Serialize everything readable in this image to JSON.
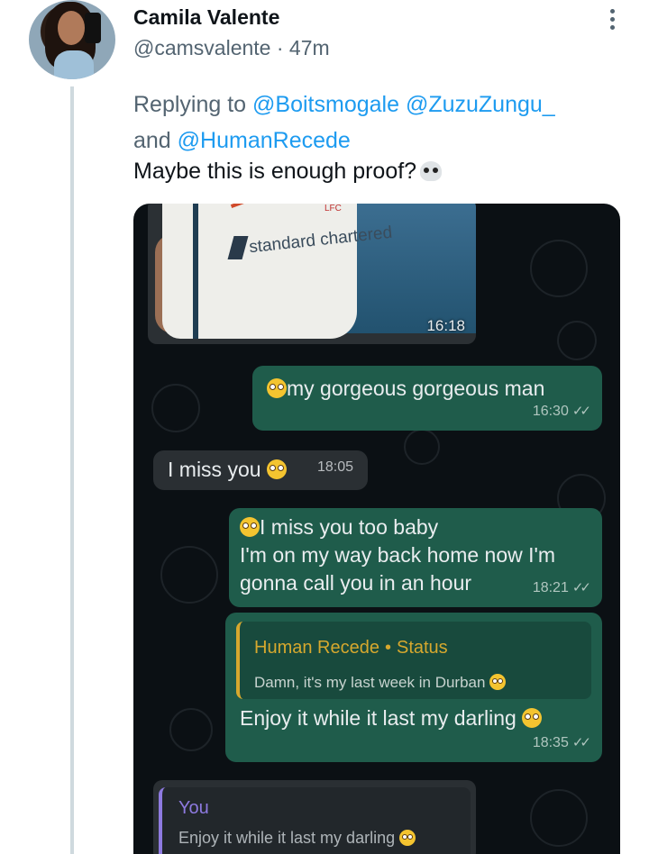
{
  "tweet": {
    "display_name": "Camila Valente",
    "handle": "@camsvalente",
    "dot": " · ",
    "time": "47m",
    "replying_prefix": "Replying to",
    "mention_1": "@Boitsmogale",
    "mention_2": "@ZuzuZungu_",
    "and_word": "and",
    "mention_3": "@HumanRecede",
    "text": "Maybe this is enough proof?"
  },
  "chat": {
    "photo": {
      "shirt_text": "standard chartered",
      "crest_text": "LFC",
      "time": "16:18"
    },
    "messages": [
      {
        "text": "my gorgeous gorgeous man",
        "time": "16:30"
      },
      {
        "text": "I miss you",
        "time": "18:05"
      },
      {
        "line1": "I miss you too baby",
        "line2": "I'm on my way back home now I'm",
        "line3": "gonna call you in an hour",
        "time": "18:21"
      },
      {
        "quote_author": "Human Recede",
        "quote_sep": "•",
        "quote_type": "Status",
        "quote_text": "Damn, it's my last week in Durban",
        "text": "Enjoy it while it last my darling",
        "time": "18:35"
      }
    ],
    "quoted_reply": {
      "author": "You",
      "text": "Enjoy it while it last my darling"
    },
    "tick_glyph": "✓✓"
  }
}
